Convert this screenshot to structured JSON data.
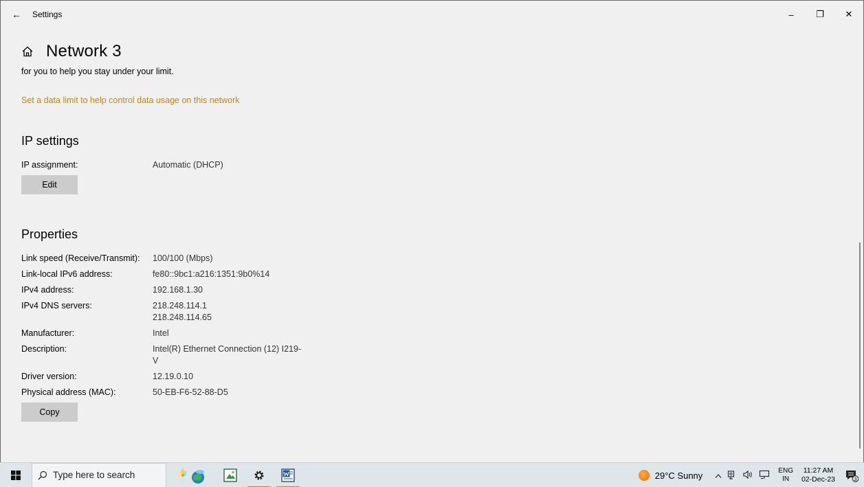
{
  "window": {
    "title": "Settings",
    "back_glyph": "←",
    "minimize_glyph": "–",
    "maximize_glyph": "❐",
    "close_glyph": "✕"
  },
  "page": {
    "title": "Network 3",
    "intro_text": "for you to help you stay under your limit.",
    "data_limit_link": "Set a data limit to help control data usage on this network"
  },
  "ip_settings": {
    "title": "IP settings",
    "assignment_label": "IP assignment:",
    "assignment_value": "Automatic (DHCP)",
    "edit_label": "Edit"
  },
  "properties": {
    "title": "Properties",
    "rows": [
      {
        "label": "Link speed (Receive/Transmit):",
        "value": "100/100 (Mbps)"
      },
      {
        "label": "Link-local IPv6 address:",
        "value": "fe80::9bc1:a216:1351:9b0%14"
      },
      {
        "label": "IPv4 address:",
        "value": "192.168.1.30"
      },
      {
        "label": "IPv4 DNS servers:",
        "value": "218.248.114.1",
        "value2": "218.248.114.65"
      },
      {
        "label": "Manufacturer:",
        "value": "Intel"
      },
      {
        "label": "Description:",
        "value": "Intel(R) Ethernet Connection (12) I219-",
        "value2": "V"
      },
      {
        "label": "Driver version:",
        "value": "12.19.0.10"
      },
      {
        "label": "Physical address (MAC):",
        "value": "50-EB-F6-52-88-D5"
      }
    ],
    "copy_label": "Copy"
  },
  "taskbar": {
    "search_placeholder": "Type here to search",
    "weather": "29°C  Sunny",
    "lang_top": "ENG",
    "lang_bottom": "IN",
    "time": "11:27 AM",
    "date": "02-Dec-23",
    "notification_count": "3",
    "tray_chevron": "^"
  },
  "colors": {
    "accent": "#c58a00",
    "background": "#f0f0f0",
    "button": "#cccccc",
    "taskbar": "#dfe6ea"
  }
}
